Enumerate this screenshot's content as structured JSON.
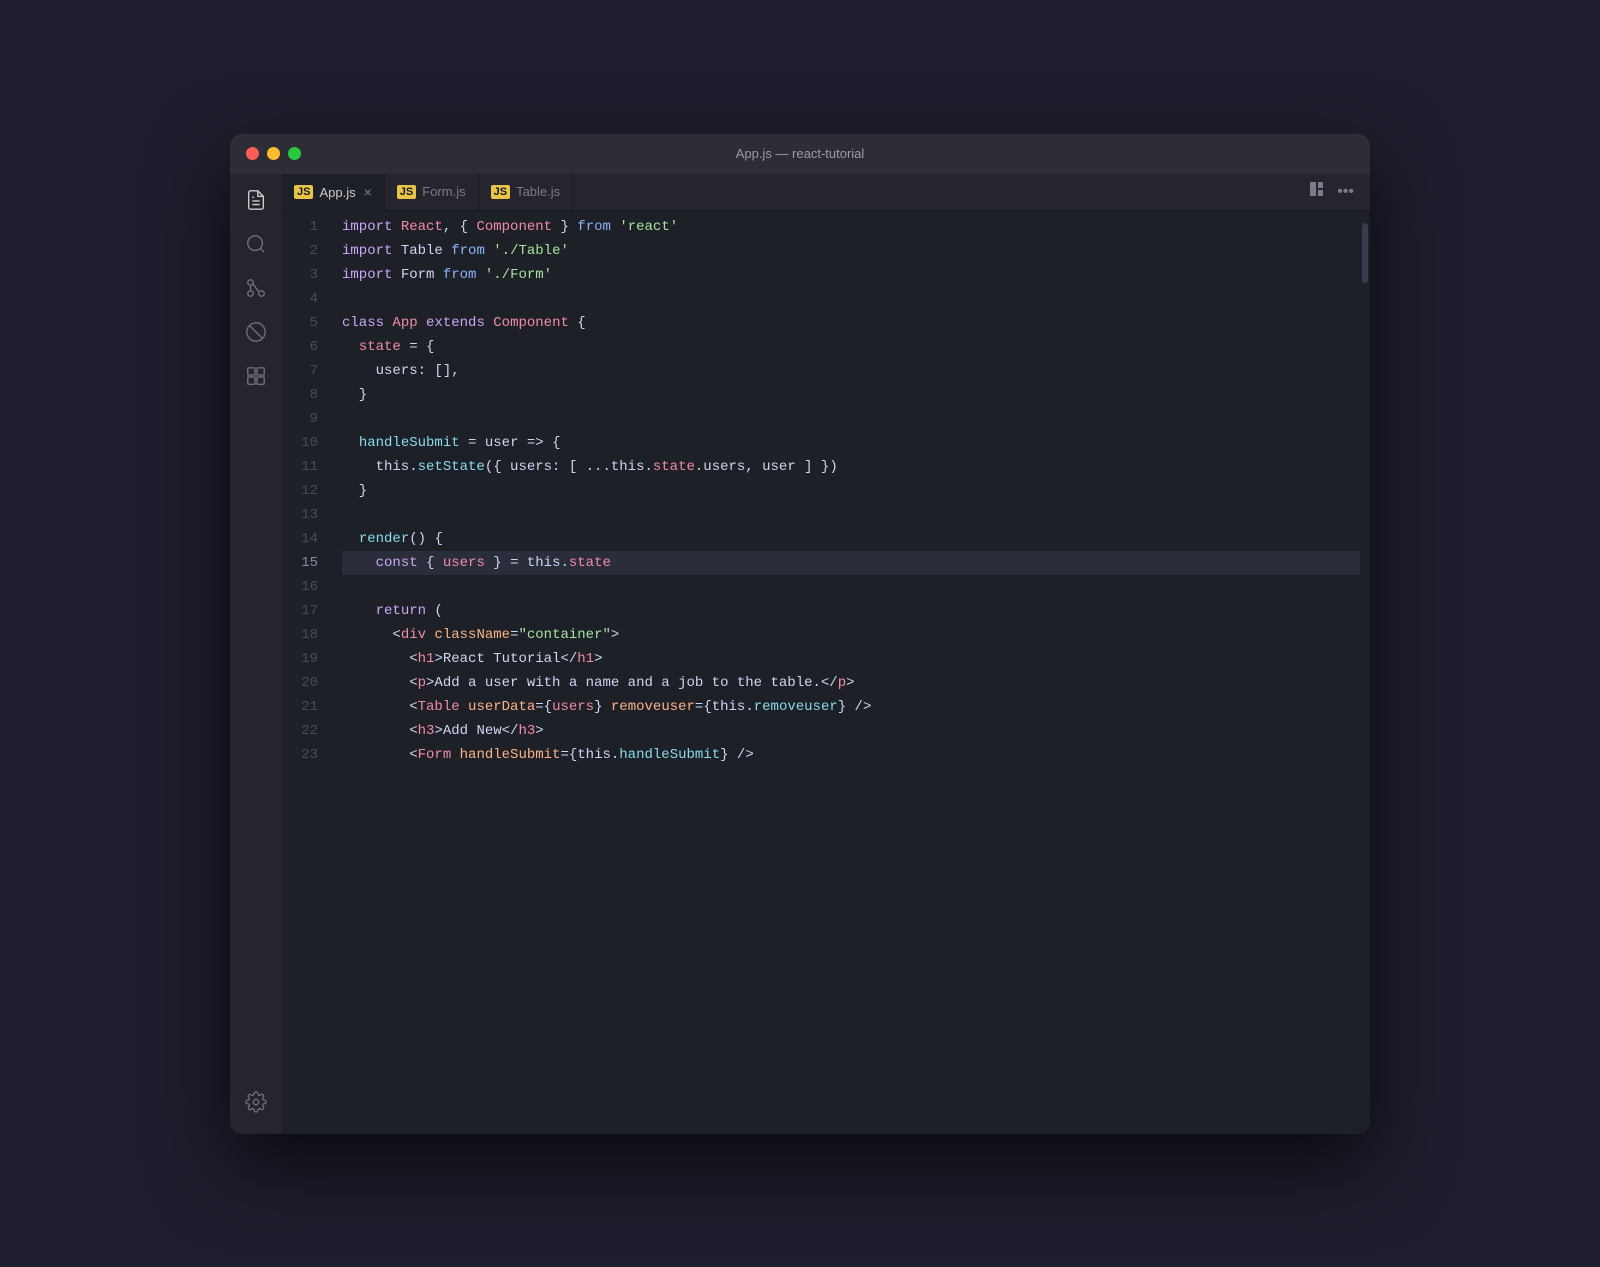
{
  "window": {
    "title": "App.js — react-tutorial"
  },
  "titlebar": {
    "buttons": {
      "close": "close",
      "minimize": "minimize",
      "maximize": "maximize"
    }
  },
  "tabs": [
    {
      "id": "app-js",
      "label": "App.js",
      "active": true,
      "closable": true
    },
    {
      "id": "form-js",
      "label": "Form.js",
      "active": false,
      "closable": false
    },
    {
      "id": "table-js",
      "label": "Table.js",
      "active": false,
      "closable": false
    }
  ],
  "activity_bar": {
    "icons": [
      {
        "id": "files",
        "symbol": "📄",
        "active": true
      },
      {
        "id": "search",
        "symbol": "🔍",
        "active": false
      },
      {
        "id": "git",
        "symbol": "⎇",
        "active": false
      },
      {
        "id": "debug",
        "symbol": "🚫",
        "active": false
      },
      {
        "id": "extensions",
        "symbol": "⊞",
        "active": false
      }
    ],
    "bottom": [
      {
        "id": "settings",
        "symbol": "⚙"
      }
    ]
  },
  "code": {
    "lines": [
      {
        "num": 1,
        "content": "import React, { Component } from 'react'"
      },
      {
        "num": 2,
        "content": "import Table from './Table'"
      },
      {
        "num": 3,
        "content": "import Form from './Form'"
      },
      {
        "num": 4,
        "content": ""
      },
      {
        "num": 5,
        "content": "class App extends Component {"
      },
      {
        "num": 6,
        "content": "  state = {"
      },
      {
        "num": 7,
        "content": "    users: [],"
      },
      {
        "num": 8,
        "content": "  }"
      },
      {
        "num": 9,
        "content": ""
      },
      {
        "num": 10,
        "content": "  handleSubmit = user => {"
      },
      {
        "num": 11,
        "content": "    this.setState({ users: [ ...this.state.users, user ] })"
      },
      {
        "num": 12,
        "content": "  }"
      },
      {
        "num": 13,
        "content": ""
      },
      {
        "num": 14,
        "content": "  render() {"
      },
      {
        "num": 15,
        "content": "    const { users } = this.state",
        "highlighted": true
      },
      {
        "num": 16,
        "content": ""
      },
      {
        "num": 17,
        "content": "    return ("
      },
      {
        "num": 18,
        "content": "      <div className=\"container\">"
      },
      {
        "num": 19,
        "content": "        <h1>React Tutorial</h1>"
      },
      {
        "num": 20,
        "content": "        <p>Add a user with a name and a job to the table.</p>"
      },
      {
        "num": 21,
        "content": "        <Table userData={users} removeuser={this.removeuser} />"
      },
      {
        "num": 22,
        "content": "        <h3>Add New</h3>"
      },
      {
        "num": 23,
        "content": "        <Form handleSubmit={this.handleSubmit} />"
      }
    ]
  }
}
